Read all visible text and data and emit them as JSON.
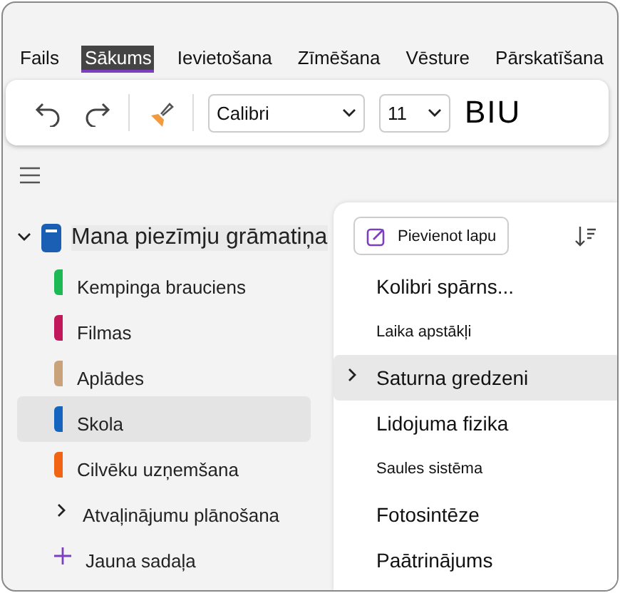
{
  "tabs": [
    {
      "label": "Fails",
      "selected": false
    },
    {
      "label": "Sākums",
      "selected": true
    },
    {
      "label": "Ievietošana",
      "selected": false
    },
    {
      "label": "Zīmēšana",
      "selected": false
    },
    {
      "label": "Vēsture",
      "selected": false
    },
    {
      "label": "Pārskatīšana",
      "selected": false
    }
  ],
  "toolbar": {
    "font": "Calibri",
    "size": "11",
    "format": "BIU"
  },
  "notebook": {
    "name": "Mana piezīmju grāmatiņa",
    "expanded": true
  },
  "sections": [
    {
      "kind": "section",
      "label": "Kempinga brauciens",
      "color": "#1db954",
      "selected": false
    },
    {
      "kind": "section",
      "label": "Filmas",
      "color": "#c2185b",
      "selected": false
    },
    {
      "kind": "section",
      "label": "Aplādes",
      "color": "#c9a27a",
      "selected": false
    },
    {
      "kind": "section",
      "label": "Skola",
      "color": "#1565c0",
      "selected": true
    },
    {
      "kind": "section",
      "label": "Cilvēku uzņemšana",
      "color": "#f06414",
      "selected": false
    },
    {
      "kind": "group",
      "label": "Atvaļinājumu plānošana"
    },
    {
      "kind": "new",
      "label": "Jauna sadaļa"
    }
  ],
  "add_page": "Pievienot lapu",
  "pages": [
    {
      "kind": "page",
      "label": "Kolibri spārns...",
      "selected": false,
      "expandable": false
    },
    {
      "kind": "subpage",
      "label": "Laika apstākļi",
      "selected": false,
      "expandable": false
    },
    {
      "kind": "page",
      "label": "Saturna gredzeni",
      "selected": true,
      "expandable": true
    },
    {
      "kind": "page",
      "label": "Lidojuma fizika",
      "selected": false,
      "expandable": false
    },
    {
      "kind": "subpage",
      "label": "Saules sistēma",
      "selected": false,
      "expandable": false
    },
    {
      "kind": "page",
      "label": "Fotosintēze",
      "selected": false,
      "expandable": false
    },
    {
      "kind": "page",
      "label": "Paātrinājums",
      "selected": false,
      "expandable": false
    }
  ]
}
